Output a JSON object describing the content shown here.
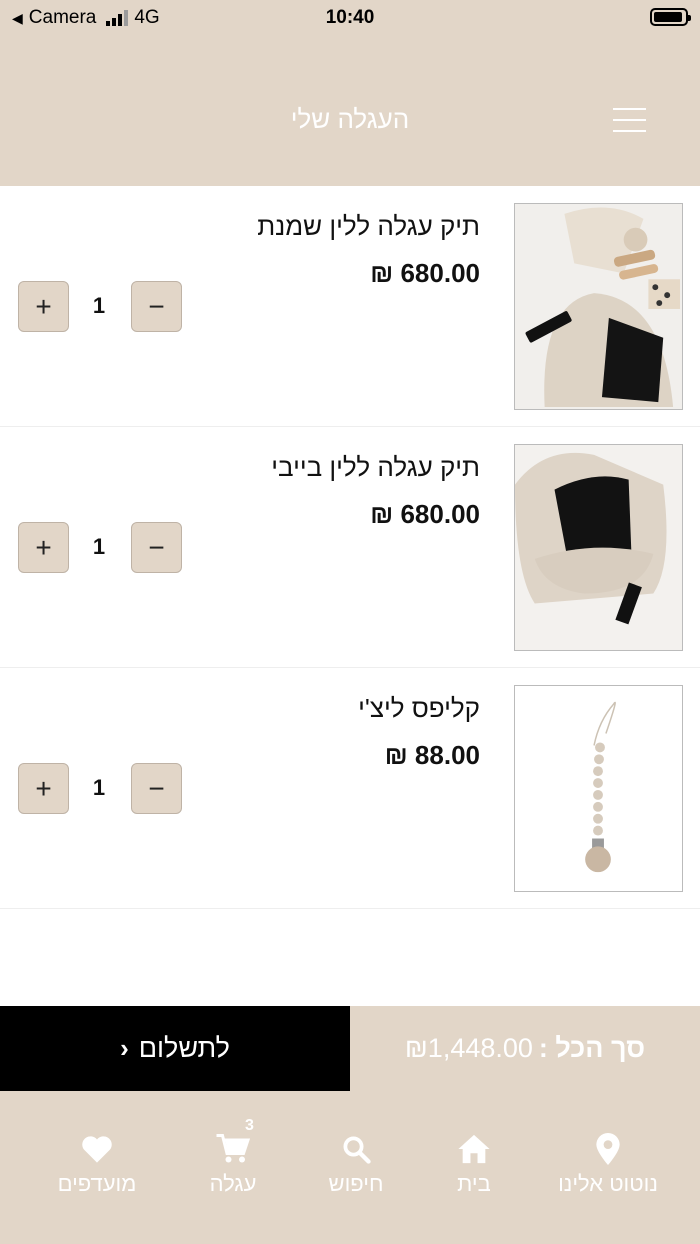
{
  "status_bar": {
    "back_label": "Camera",
    "network": "4G",
    "time": "10:40"
  },
  "header": {
    "title": "העגלה שלי"
  },
  "items": [
    {
      "name": "תיק עגלה ללין שמנת",
      "price": "680.00 ₪",
      "quantity": "1",
      "minus": "−",
      "plus": "+"
    },
    {
      "name": "תיק עגלה ללין בייבי",
      "price": "680.00 ₪",
      "quantity": "1",
      "minus": "−",
      "plus": "+"
    },
    {
      "name": "קליפס ליצ'י",
      "price": "88.00 ₪",
      "quantity": "1",
      "minus": "−",
      "plus": "+"
    }
  ],
  "checkout": {
    "button_label": "לתשלום",
    "chevron": "‹",
    "total_label": "סך הכל :",
    "total_value": "₪1,448.00"
  },
  "tabbar": {
    "favorites": "מועדפים",
    "cart": "עגלה",
    "cart_badge": "3",
    "search": "חיפוש",
    "home": "בית",
    "contact": "נוטוט אלינו"
  },
  "colors": {
    "beige": "#e2d6c8",
    "black": "#000000",
    "white": "#ffffff"
  }
}
